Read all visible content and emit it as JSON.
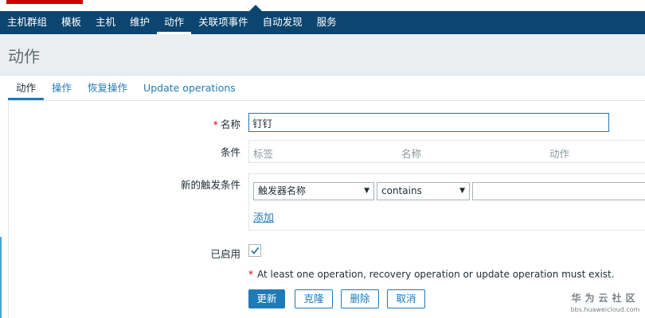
{
  "nav": {
    "items": [
      {
        "label": "主机群组"
      },
      {
        "label": "模板"
      },
      {
        "label": "主机"
      },
      {
        "label": "维护"
      },
      {
        "label": "动作",
        "active": true
      },
      {
        "label": "关联项事件"
      },
      {
        "label": "自动发现"
      },
      {
        "label": "服务"
      }
    ]
  },
  "page": {
    "title": "动作"
  },
  "tabs": [
    {
      "label": "动作",
      "active": true
    },
    {
      "label": "操作"
    },
    {
      "label": "恢复操作"
    },
    {
      "label": "Update operations"
    }
  ],
  "form": {
    "name_label": "名称",
    "required_mark": "*",
    "name_value": "钉钉",
    "conditions_label": "条件",
    "conditions_columns": [
      "标签",
      "名称",
      "动作"
    ],
    "new_condition_label": "新的触发条件",
    "condition_type_value": "触发器名称",
    "condition_operator_value": "contains",
    "condition_value": "",
    "add_link": "添加",
    "enabled_label": "已启用",
    "enabled_checked": true,
    "warning_text": "At least one operation, recovery operation or update operation must exist."
  },
  "buttons": {
    "update": "更新",
    "clone": "克隆",
    "delete": "删除",
    "cancel": "取消"
  },
  "watermark": {
    "name": "华为云社区",
    "url": "bbs.huaweicloud.com"
  },
  "colors": {
    "nav_bg": "#0b4570",
    "accent": "#1f7ab8",
    "required": "#d40000"
  },
  "icons": {
    "dropdown": "chevron-down-icon",
    "checkbox": "checkmark-icon"
  }
}
